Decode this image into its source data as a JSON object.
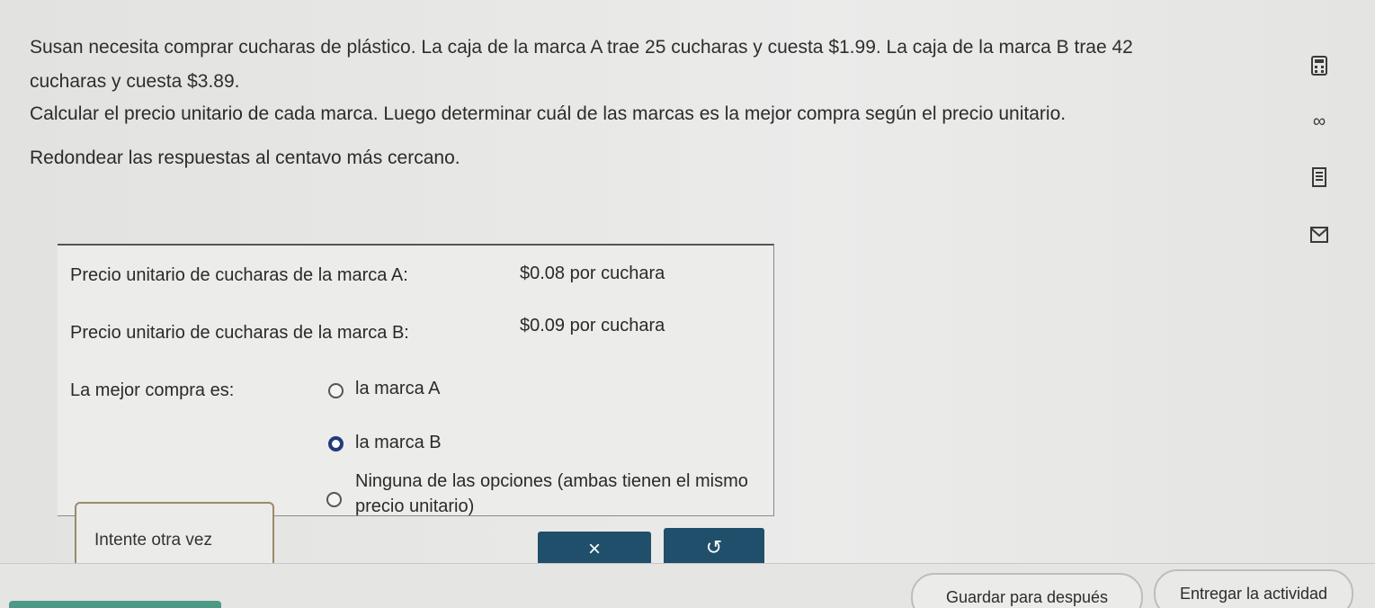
{
  "problem": {
    "line1": "Susan necesita comprar cucharas de plástico. La caja de la marca A trae 25 cucharas y cuesta $1.99. La caja de la marca B trae 42",
    "line2": "cucharas y cuesta $3.89.",
    "instruction": "Calcular el precio unitario de cada marca. Luego determinar cuál de las marcas es la mejor compra según el precio unitario.",
    "rounding": "Redondear las respuestas al centavo más cercano."
  },
  "answers": {
    "brand_a_label": "Precio unitario de cucharas de la marca A:",
    "brand_a_value": "$0.08 por cuchara",
    "brand_b_label": "Precio unitario de cucharas de la marca B:",
    "brand_b_value": "$0.09 por cuchara",
    "best_buy_label": "La mejor compra es:",
    "options": [
      {
        "label": "la marca A",
        "selected": false
      },
      {
        "label": "la marca B",
        "selected": true
      },
      {
        "label": "Ninguna de las opciones (ambas tienen el mismo precio unitario)",
        "selected": false
      }
    ]
  },
  "feedback": {
    "text": "Intente otra vez"
  },
  "buttons": {
    "clear": "×",
    "undo": "↺",
    "save_later": "Guardar para después",
    "submit": "Entregar la actividad"
  },
  "tools": {
    "calculator": "calculator-icon",
    "infinity": "∞",
    "notes": "notes-icon",
    "mail": "mail-icon"
  },
  "colors": {
    "primary_button": "#1f4f6a",
    "selected_radio": "#233a7a",
    "accent_strip": "#4b9a86"
  }
}
